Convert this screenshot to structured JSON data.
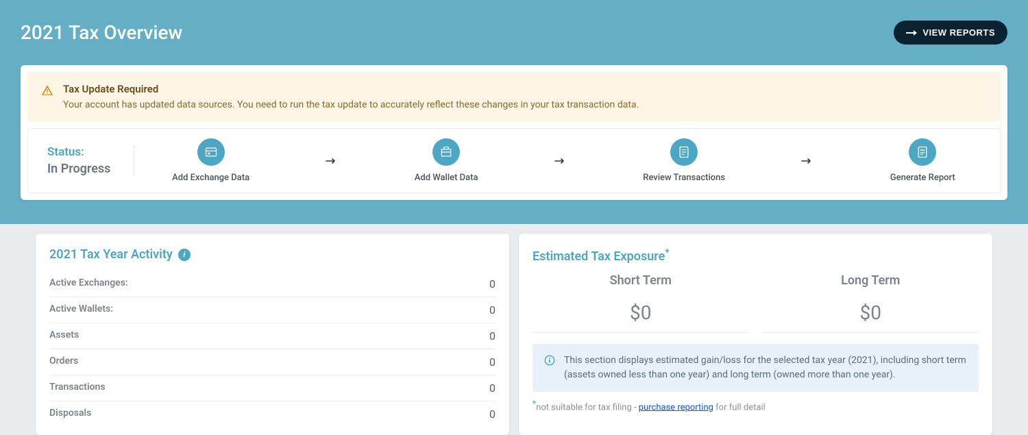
{
  "header": {
    "title": "2021 Tax Overview",
    "view_reports_label": "VIEW REPORTS"
  },
  "alert": {
    "title": "Tax Update Required",
    "body": "Your account has updated data sources. You need to run the tax update to accurately reflect these changes in your tax transaction data."
  },
  "status": {
    "label": "Status:",
    "value": "In Progress"
  },
  "steps": [
    {
      "label": "Add Exchange Data"
    },
    {
      "label": "Add Wallet Data"
    },
    {
      "label": "Review Transactions"
    },
    {
      "label": "Generate Report"
    }
  ],
  "activity": {
    "title": "2021 Tax Year Activity",
    "rows": [
      {
        "label": "Active Exchanges:",
        "value": "0"
      },
      {
        "label": "Active Wallets:",
        "value": "0"
      },
      {
        "label": "Assets",
        "value": "0"
      },
      {
        "label": "Orders",
        "value": "0"
      },
      {
        "label": "Transactions",
        "value": "0"
      },
      {
        "label": "Disposals",
        "value": "0"
      }
    ]
  },
  "exposure": {
    "title": "Estimated Tax Exposure",
    "short_term_label": "Short Term",
    "long_term_label": "Long Term",
    "short_term_value": "$0",
    "long_term_value": "$0",
    "info": "This section displays estimated gain/loss for the selected tax year (2021), including short term (assets owned less than one year) and long term (owned more than one year).",
    "footnote_prefix": "not suitable for tax filing - ",
    "footnote_link": "purchase reporting",
    "footnote_suffix": " for full detail"
  }
}
